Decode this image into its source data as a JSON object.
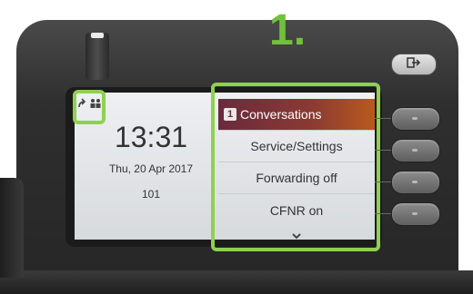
{
  "step": {
    "label": "1."
  },
  "status_bar": {
    "icons": [
      "forward-arrow-icon",
      "users-icon"
    ],
    "highlight_color": "#8fd14f"
  },
  "idle_screen": {
    "time": "13:31",
    "date": "Thu, 20 Apr 2017",
    "extension": "101"
  },
  "menu": {
    "items": [
      {
        "number": "1",
        "label": "Conversations",
        "selected": true
      },
      {
        "number": "",
        "label": "Service/Settings",
        "selected": false
      },
      {
        "number": "",
        "label": "Forwarding off",
        "selected": false
      },
      {
        "number": "",
        "label": "CFNR on",
        "selected": false
      }
    ],
    "selected_color": "#8b3a32",
    "more_indicator": "chevron-down-icon"
  },
  "hardware": {
    "logout_key_icon": "logout-icon",
    "softkey_count": 4
  }
}
